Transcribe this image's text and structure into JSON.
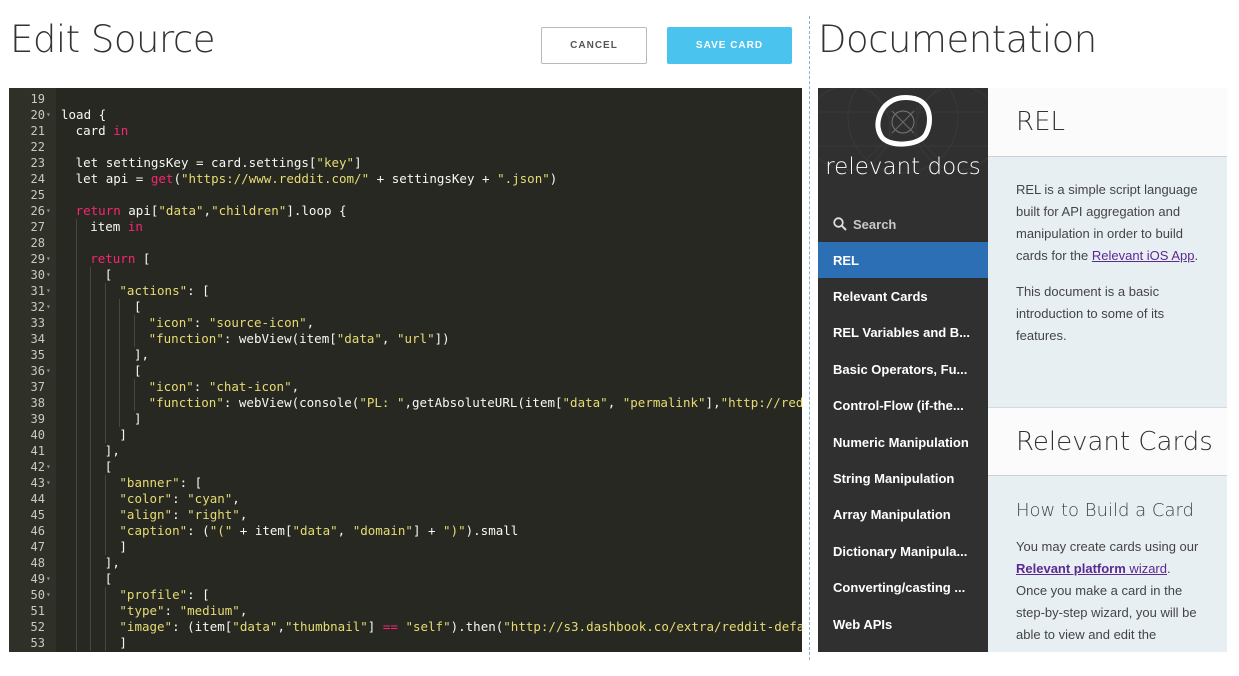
{
  "editor": {
    "title": "Edit Source",
    "cancel_label": "CANCEL",
    "save_label": "SAVE CARD",
    "lines": [
      {
        "n": "19",
        "fold": false,
        "indent": 0,
        "segs": []
      },
      {
        "n": "20",
        "fold": true,
        "indent": 0,
        "segs": [
          {
            "t": "load {",
            "c": ""
          }
        ]
      },
      {
        "n": "21",
        "fold": false,
        "indent": 1,
        "segs": [
          {
            "t": "card ",
            "c": ""
          },
          {
            "t": "in",
            "c": "kw"
          }
        ]
      },
      {
        "n": "22",
        "fold": false,
        "indent": 1,
        "segs": []
      },
      {
        "n": "23",
        "fold": false,
        "indent": 1,
        "segs": [
          {
            "t": "let settingsKey = card.settings[",
            "c": ""
          },
          {
            "t": "\"key\"",
            "c": "str"
          },
          {
            "t": "]",
            "c": ""
          }
        ]
      },
      {
        "n": "24",
        "fold": false,
        "indent": 1,
        "segs": [
          {
            "t": "let api = ",
            "c": ""
          },
          {
            "t": "get",
            "c": "kw"
          },
          {
            "t": "(",
            "c": ""
          },
          {
            "t": "\"https://www.reddit.com/\"",
            "c": "str"
          },
          {
            "t": " + settingsKey + ",
            "c": ""
          },
          {
            "t": "\".json\"",
            "c": "str"
          },
          {
            "t": ")",
            "c": ""
          }
        ]
      },
      {
        "n": "25",
        "fold": false,
        "indent": 1,
        "segs": []
      },
      {
        "n": "26",
        "fold": true,
        "indent": 1,
        "segs": [
          {
            "t": "return",
            "c": "kw"
          },
          {
            "t": " api[",
            "c": ""
          },
          {
            "t": "\"data\"",
            "c": "str"
          },
          {
            "t": ",",
            "c": ""
          },
          {
            "t": "\"children\"",
            "c": "str"
          },
          {
            "t": "].loop {",
            "c": ""
          }
        ]
      },
      {
        "n": "27",
        "fold": false,
        "indent": 2,
        "segs": [
          {
            "t": "item ",
            "c": ""
          },
          {
            "t": "in",
            "c": "kw"
          }
        ]
      },
      {
        "n": "28",
        "fold": false,
        "indent": 2,
        "segs": []
      },
      {
        "n": "29",
        "fold": true,
        "indent": 2,
        "segs": [
          {
            "t": "return",
            "c": "kw"
          },
          {
            "t": " [",
            "c": ""
          }
        ]
      },
      {
        "n": "30",
        "fold": true,
        "indent": 3,
        "segs": [
          {
            "t": "[",
            "c": ""
          }
        ]
      },
      {
        "n": "31",
        "fold": true,
        "indent": 4,
        "segs": [
          {
            "t": "\"actions\"",
            "c": "str"
          },
          {
            "t": ": [",
            "c": ""
          }
        ]
      },
      {
        "n": "32",
        "fold": true,
        "indent": 5,
        "segs": [
          {
            "t": "[",
            "c": ""
          }
        ]
      },
      {
        "n": "33",
        "fold": false,
        "indent": 6,
        "segs": [
          {
            "t": "\"icon\"",
            "c": "str"
          },
          {
            "t": ": ",
            "c": ""
          },
          {
            "t": "\"source-icon\"",
            "c": "str"
          },
          {
            "t": ",",
            "c": ""
          }
        ]
      },
      {
        "n": "34",
        "fold": false,
        "indent": 6,
        "segs": [
          {
            "t": "\"function\"",
            "c": "str"
          },
          {
            "t": ": webView(item[",
            "c": ""
          },
          {
            "t": "\"data\"",
            "c": "str"
          },
          {
            "t": ", ",
            "c": ""
          },
          {
            "t": "\"url\"",
            "c": "str"
          },
          {
            "t": "])",
            "c": ""
          }
        ]
      },
      {
        "n": "35",
        "fold": false,
        "indent": 5,
        "segs": [
          {
            "t": "],",
            "c": ""
          }
        ]
      },
      {
        "n": "36",
        "fold": true,
        "indent": 5,
        "segs": [
          {
            "t": "[",
            "c": ""
          }
        ]
      },
      {
        "n": "37",
        "fold": false,
        "indent": 6,
        "segs": [
          {
            "t": "\"icon\"",
            "c": "str"
          },
          {
            "t": ": ",
            "c": ""
          },
          {
            "t": "\"chat-icon\"",
            "c": "str"
          },
          {
            "t": ",",
            "c": ""
          }
        ]
      },
      {
        "n": "38",
        "fold": false,
        "indent": 6,
        "segs": [
          {
            "t": "\"function\"",
            "c": "str"
          },
          {
            "t": ": webView(console(",
            "c": ""
          },
          {
            "t": "\"PL: \"",
            "c": "str"
          },
          {
            "t": ",getAbsoluteURL(item[",
            "c": ""
          },
          {
            "t": "\"data\"",
            "c": "str"
          },
          {
            "t": ", ",
            "c": ""
          },
          {
            "t": "\"permalink\"",
            "c": "str"
          },
          {
            "t": "],",
            "c": ""
          },
          {
            "t": "\"http://reddi",
            "c": "str"
          }
        ]
      },
      {
        "n": "39",
        "fold": false,
        "indent": 5,
        "segs": [
          {
            "t": "]",
            "c": ""
          }
        ]
      },
      {
        "n": "40",
        "fold": false,
        "indent": 4,
        "segs": [
          {
            "t": "]",
            "c": ""
          }
        ]
      },
      {
        "n": "41",
        "fold": false,
        "indent": 3,
        "segs": [
          {
            "t": "],",
            "c": ""
          }
        ]
      },
      {
        "n": "42",
        "fold": true,
        "indent": 3,
        "segs": [
          {
            "t": "[",
            "c": ""
          }
        ]
      },
      {
        "n": "43",
        "fold": true,
        "indent": 4,
        "segs": [
          {
            "t": "\"banner\"",
            "c": "str"
          },
          {
            "t": ": [",
            "c": ""
          }
        ]
      },
      {
        "n": "44",
        "fold": false,
        "indent": 4,
        "segs": [
          {
            "t": "\"color\"",
            "c": "str"
          },
          {
            "t": ": ",
            "c": ""
          },
          {
            "t": "\"cyan\"",
            "c": "str"
          },
          {
            "t": ",",
            "c": ""
          }
        ]
      },
      {
        "n": "45",
        "fold": false,
        "indent": 4,
        "segs": [
          {
            "t": "\"align\"",
            "c": "str"
          },
          {
            "t": ": ",
            "c": ""
          },
          {
            "t": "\"right\"",
            "c": "str"
          },
          {
            "t": ",",
            "c": ""
          }
        ]
      },
      {
        "n": "46",
        "fold": false,
        "indent": 4,
        "segs": [
          {
            "t": "\"caption\"",
            "c": "str"
          },
          {
            "t": ": (",
            "c": ""
          },
          {
            "t": "\"(\"",
            "c": "str"
          },
          {
            "t": " + item[",
            "c": ""
          },
          {
            "t": "\"data\"",
            "c": "str"
          },
          {
            "t": ", ",
            "c": ""
          },
          {
            "t": "\"domain\"",
            "c": "str"
          },
          {
            "t": "] + ",
            "c": ""
          },
          {
            "t": "\")\"",
            "c": "str"
          },
          {
            "t": ").small",
            "c": ""
          }
        ]
      },
      {
        "n": "47",
        "fold": false,
        "indent": 4,
        "segs": [
          {
            "t": "]",
            "c": ""
          }
        ]
      },
      {
        "n": "48",
        "fold": false,
        "indent": 3,
        "segs": [
          {
            "t": "],",
            "c": ""
          }
        ]
      },
      {
        "n": "49",
        "fold": true,
        "indent": 3,
        "segs": [
          {
            "t": "[",
            "c": ""
          }
        ]
      },
      {
        "n": "50",
        "fold": true,
        "indent": 4,
        "segs": [
          {
            "t": "\"profile\"",
            "c": "str"
          },
          {
            "t": ": [",
            "c": ""
          }
        ]
      },
      {
        "n": "51",
        "fold": false,
        "indent": 4,
        "segs": [
          {
            "t": "\"type\"",
            "c": "str"
          },
          {
            "t": ": ",
            "c": ""
          },
          {
            "t": "\"medium\"",
            "c": "str"
          },
          {
            "t": ",",
            "c": ""
          }
        ]
      },
      {
        "n": "52",
        "fold": false,
        "indent": 4,
        "segs": [
          {
            "t": "\"image\"",
            "c": "str"
          },
          {
            "t": ": (item[",
            "c": ""
          },
          {
            "t": "\"data\"",
            "c": "str"
          },
          {
            "t": ",",
            "c": ""
          },
          {
            "t": "\"thumbnail\"",
            "c": "str"
          },
          {
            "t": "] ",
            "c": ""
          },
          {
            "t": "==",
            "c": "kw"
          },
          {
            "t": " ",
            "c": ""
          },
          {
            "t": "\"self\"",
            "c": "str"
          },
          {
            "t": ").then(",
            "c": ""
          },
          {
            "t": "\"http://s3.dashbook.co/extra/reddit-defaul",
            "c": "str"
          }
        ]
      },
      {
        "n": "53",
        "fold": false,
        "indent": 4,
        "segs": [
          {
            "t": "]",
            "c": ""
          }
        ]
      }
    ]
  },
  "docs": {
    "title": "Documentation",
    "logo_text": "relevant docs",
    "search_label": "Search",
    "nav": [
      {
        "label": "REL",
        "active": true
      },
      {
        "label": "Relevant Cards",
        "active": false
      },
      {
        "label": "REL Variables and B...",
        "active": false
      },
      {
        "label": "Basic Operators, Fu...",
        "active": false
      },
      {
        "label": "Control-Flow (if-the...",
        "active": false
      },
      {
        "label": "Numeric Manipulation",
        "active": false
      },
      {
        "label": "String Manipulation",
        "active": false
      },
      {
        "label": "Array Manipulation",
        "active": false
      },
      {
        "label": "Dictionary Manipula...",
        "active": false
      },
      {
        "label": "Converting/casting ...",
        "active": false
      },
      {
        "label": "Web APIs",
        "active": false
      }
    ],
    "rel": {
      "heading": "REL",
      "p1_text": "REL is a simple script language built for API aggregation and manipulation in order to build cards for the ",
      "p1_link": "Relevant iOS App",
      "p1_end": ".",
      "p2": "This document is a basic introduction to some of its features."
    },
    "cards": {
      "heading": "Relevant Cards",
      "subheading": "How to Build a Card",
      "p1_text": "You may create cards using our ",
      "p1_link_bold": "Relevant platform",
      "p1_link": " wizard",
      "p1_end": ".",
      "p2": "Once you make a card in the step-by-step wizard, you will be able to view and edit the"
    }
  },
  "colors": {
    "editor_bg": "#272822",
    "save_button": "#4ac3ee",
    "nav_active": "#2d6fb4",
    "sidebar_bg": "#303030",
    "string": "#e6db74",
    "keyword": "#f92672",
    "link": "#5b2a91"
  }
}
